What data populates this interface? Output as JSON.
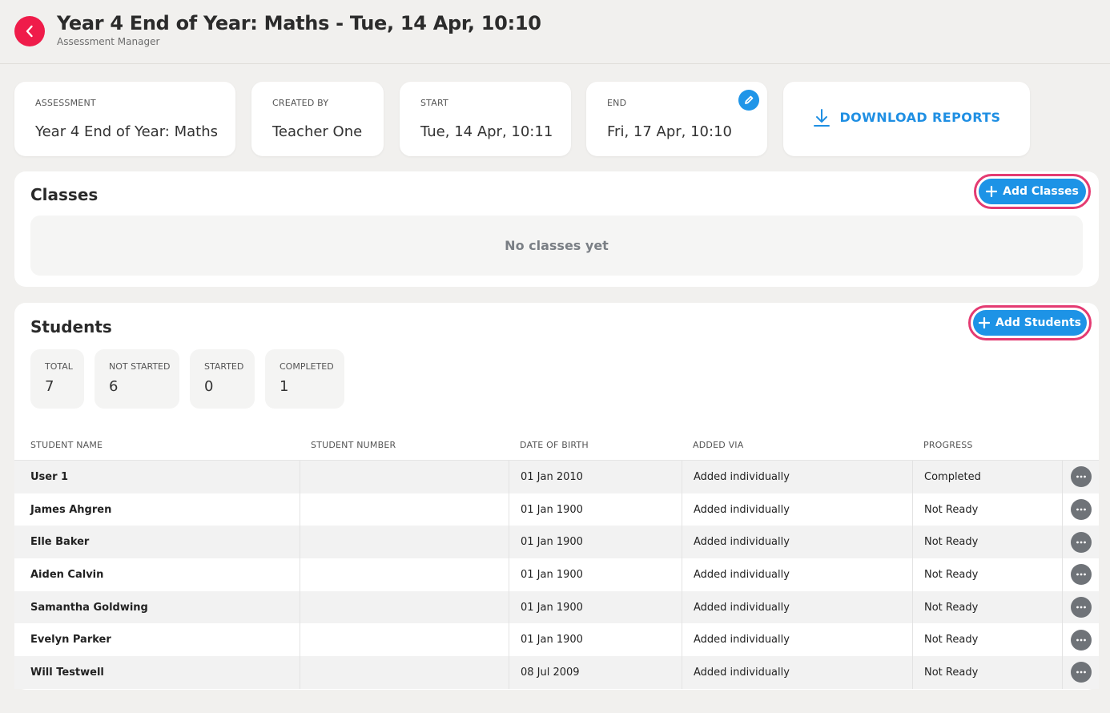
{
  "header": {
    "title": "Year 4 End of Year: Maths - Tue, 14 Apr, 10:10",
    "subtitle": "Assessment Manager"
  },
  "cards": {
    "assessment": {
      "label": "ASSESSMENT",
      "value": "Year 4 End of Year: Maths"
    },
    "created_by": {
      "label": "CREATED BY",
      "value": "Teacher One"
    },
    "start": {
      "label": "START",
      "value": "Tue, 14 Apr, 10:11"
    },
    "end": {
      "label": "END",
      "value": "Fri, 17 Apr, 10:10"
    },
    "download": {
      "label": "DOWNLOAD REPORTS"
    }
  },
  "classes": {
    "title": "Classes",
    "add_label": "Add Classes",
    "empty_text": "No classes yet"
  },
  "students": {
    "title": "Students",
    "add_label": "Add Students",
    "stats": [
      {
        "label": "TOTAL",
        "value": "7"
      },
      {
        "label": "NOT STARTED",
        "value": "6"
      },
      {
        "label": "STARTED",
        "value": "0"
      },
      {
        "label": "COMPLETED",
        "value": "1"
      }
    ],
    "columns": [
      "STUDENT NAME",
      "STUDENT NUMBER",
      "DATE OF BIRTH",
      "ADDED VIA",
      "PROGRESS"
    ],
    "rows": [
      {
        "name": "User 1",
        "number": "",
        "dob": "01 Jan 2010",
        "added_via": "Added individually",
        "progress": "Completed"
      },
      {
        "name": "James Ahgren",
        "number": "",
        "dob": "01 Jan 1900",
        "added_via": "Added individually",
        "progress": "Not Ready"
      },
      {
        "name": "Elle Baker",
        "number": "",
        "dob": "01 Jan 1900",
        "added_via": "Added individually",
        "progress": "Not Ready"
      },
      {
        "name": "Aiden Calvin",
        "number": "",
        "dob": "01 Jan 1900",
        "added_via": "Added individually",
        "progress": "Not Ready"
      },
      {
        "name": "Samantha Goldwing",
        "number": "",
        "dob": "01 Jan 1900",
        "added_via": "Added individually",
        "progress": "Not Ready"
      },
      {
        "name": "Evelyn Parker",
        "number": "",
        "dob": "01 Jan 1900",
        "added_via": "Added individually",
        "progress": "Not Ready"
      },
      {
        "name": "Will Testwell",
        "number": "",
        "dob": "08 Jul 2009",
        "added_via": "Added individually",
        "progress": "Not Ready"
      }
    ]
  },
  "colors": {
    "accent": "#1d93e6",
    "back_button": "#ef1c4a",
    "highlight_ring": "#e43b72"
  },
  "icons": {
    "back": "chevron-left-icon",
    "edit": "pencil-icon",
    "download": "download-icon",
    "add": "plus-icon",
    "row_menu": "ellipsis-icon"
  }
}
